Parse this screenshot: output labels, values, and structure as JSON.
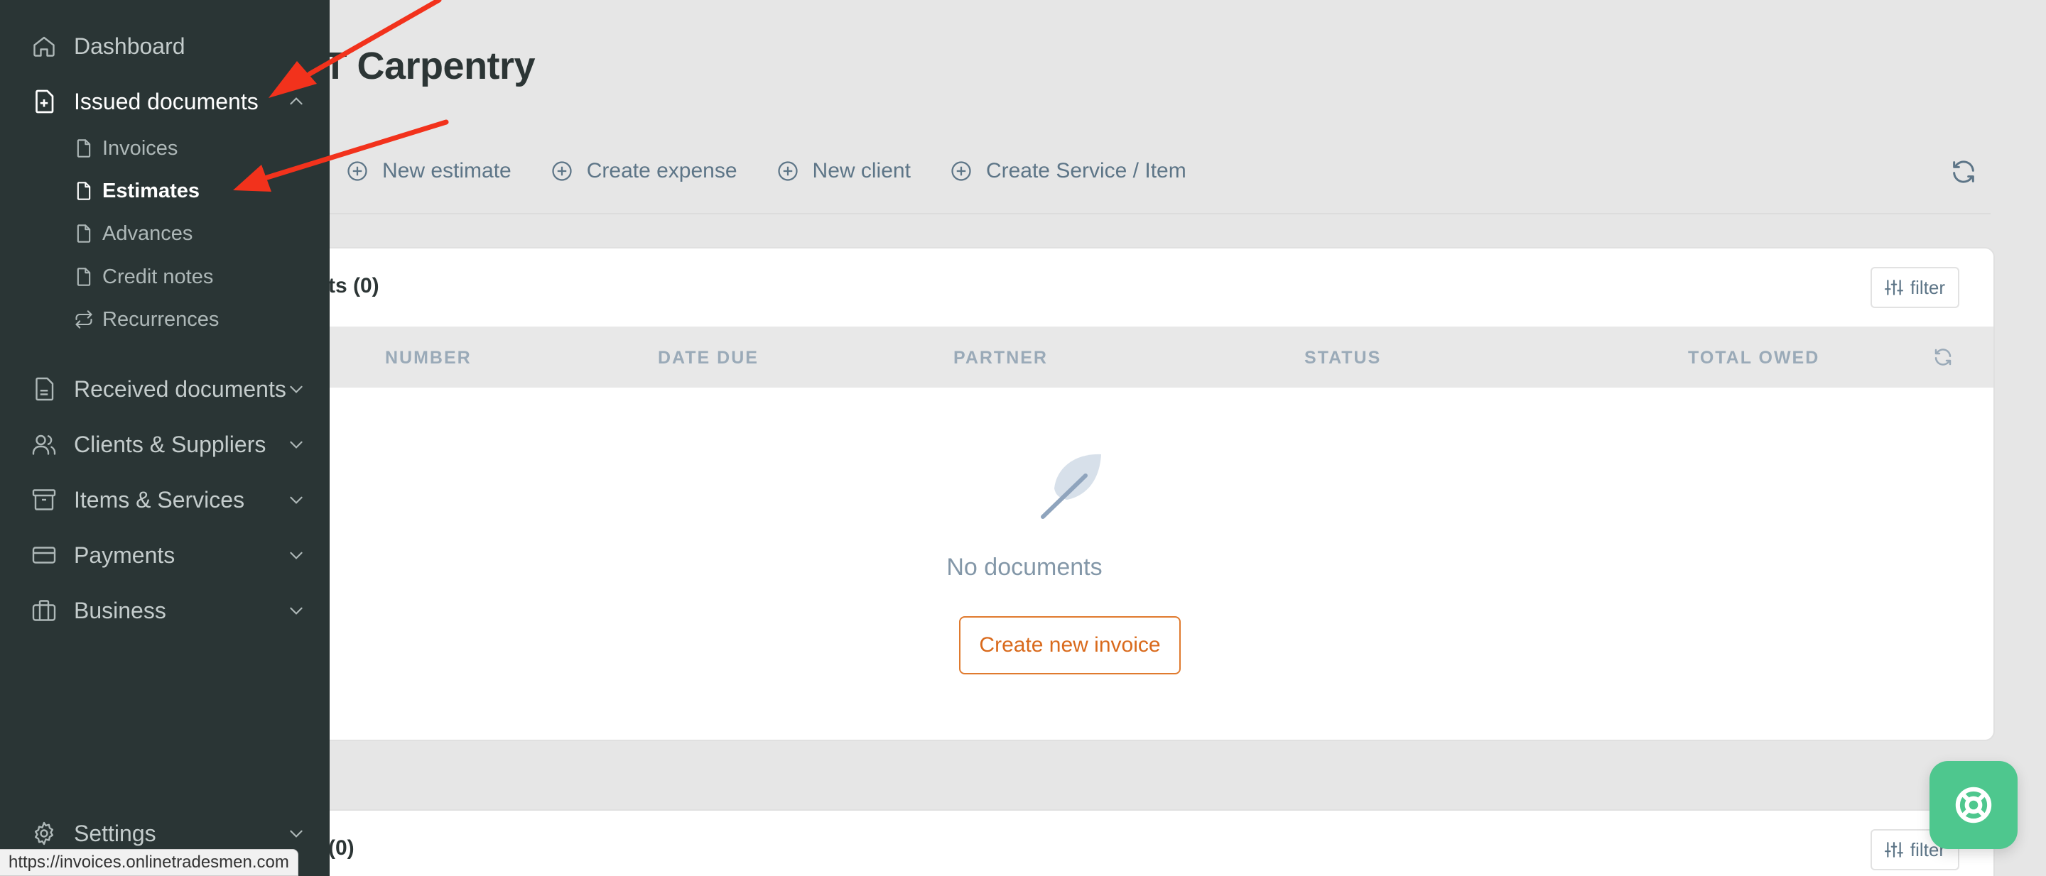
{
  "page": {
    "title": "VT Carpentry"
  },
  "actions": [
    {
      "label": "New estimate",
      "icon": "plus-circle-icon"
    },
    {
      "label": "Create expense",
      "icon": "plus-circle-icon"
    },
    {
      "label": "New client",
      "icon": "plus-circle-icon"
    },
    {
      "label": "Create Service / Item",
      "icon": "plus-circle-icon"
    }
  ],
  "card1": {
    "title": "ts (0)",
    "filter_label": "filter",
    "columns": [
      "NUMBER",
      "DATE DUE",
      "PARTNER",
      "STATUS",
      "TOTAL OWED"
    ],
    "empty_text": "No documents",
    "create_label": "Create new invoice"
  },
  "card2": {
    "title": "(0)",
    "filter_label": "filter"
  },
  "sidebar": {
    "items": [
      {
        "label": "Dashboard",
        "icon": "home-icon"
      },
      {
        "label": "Issued documents",
        "icon": "file-plus-icon",
        "expanded": true
      },
      {
        "label": "Received documents",
        "icon": "file-icon"
      },
      {
        "label": "Clients & Suppliers",
        "icon": "users-icon"
      },
      {
        "label": "Items & Services",
        "icon": "archive-icon"
      },
      {
        "label": "Payments",
        "icon": "credit-card-icon"
      },
      {
        "label": "Business",
        "icon": "briefcase-icon"
      },
      {
        "label": "Settings",
        "icon": "gear-icon"
      }
    ],
    "sub_items": [
      {
        "label": "Invoices",
        "icon": "document-icon"
      },
      {
        "label": "Estimates",
        "icon": "document-icon",
        "active": true
      },
      {
        "label": "Advances",
        "icon": "document-icon"
      },
      {
        "label": "Credit notes",
        "icon": "document-icon"
      },
      {
        "label": "Recurrences",
        "icon": "repeat-icon"
      }
    ]
  },
  "status_bar": {
    "url": "https://invoices.onlinetradesmen.com"
  },
  "colors": {
    "sidebar_bg": "#2a3535",
    "accent_orange": "#e07a2e",
    "fab_green": "#4ec78e",
    "annotation_red": "#f2321c"
  }
}
